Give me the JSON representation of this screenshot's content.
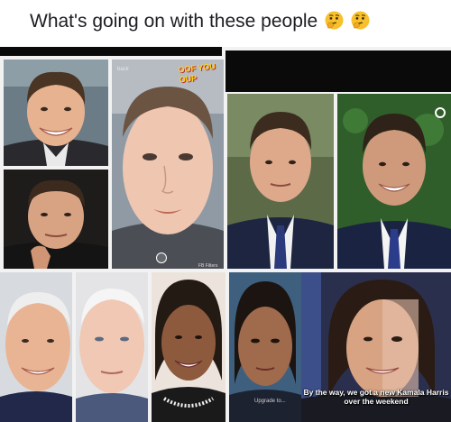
{
  "post": {
    "caption": "What's going on with these people",
    "emoji_1": "thinking-face",
    "emoji_2": "thinking-face"
  },
  "collage": {
    "story_header": "back",
    "story_sticker": "OOF YOU OUP",
    "story_credit": "FB Filters",
    "watermark": "Upgrade to...",
    "overlay_caption": "By the way, we got a new Kamala Harris over the weekend"
  },
  "colors": {
    "background": "#ffffff",
    "text": "#1c1e21",
    "emoji_face": "#f7c02c"
  }
}
